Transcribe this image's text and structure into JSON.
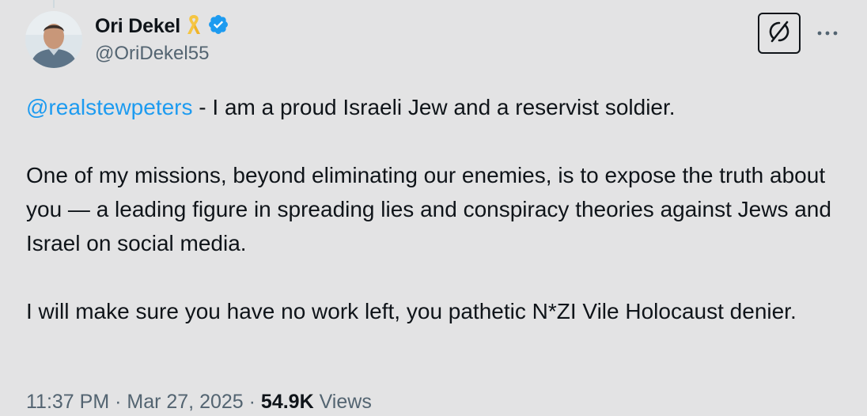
{
  "author": {
    "display_name": "Ori Dekel",
    "handle": "@OriDekel55",
    "badge_icon": "yellow-ribbon-icon",
    "verified_icon": "verified-badge-icon",
    "verified_color": "#1d9bf0",
    "ribbon_color": "#f5c542"
  },
  "actions": {
    "grok_icon": "grok-icon",
    "more_icon": "more-options-icon"
  },
  "tweet": {
    "mention": "@realstewpeters",
    "line1_rest": " - I am a proud Israeli Jew and a reservist soldier.",
    "paragraph2": "One of my missions, beyond eliminating our enemies, is to expose the truth about you — a leading figure in spreading lies and conspiracy theories against Jews and Israel on social media.",
    "paragraph3": "I will make sure you have no work left, you pathetic N*ZI Vile Holocaust denier."
  },
  "meta": {
    "time": "11:37 PM",
    "separator1": " · ",
    "date": "Mar 27, 2025",
    "separator2": " · ",
    "views_count": "54.9K",
    "views_label": " Views"
  },
  "colors": {
    "background": "#e3e3e4",
    "text": "#0f1419",
    "secondary_text": "#536471",
    "link": "#1d9bf0"
  }
}
